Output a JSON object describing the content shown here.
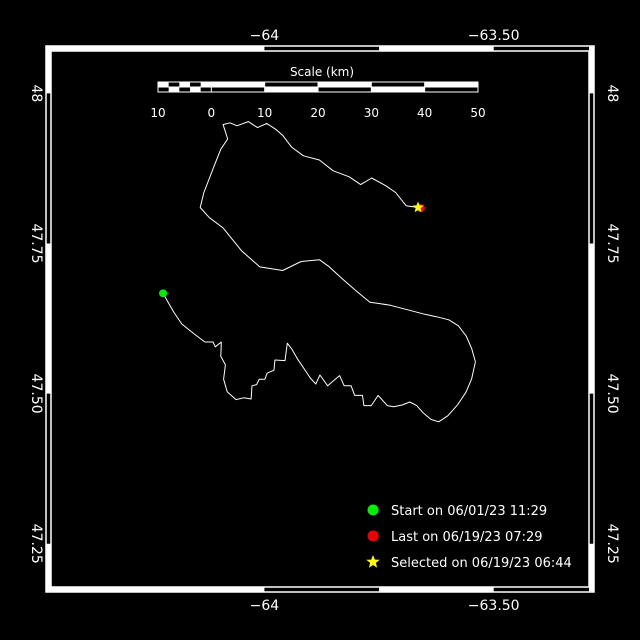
{
  "map": {
    "axes": {
      "lon_ticks": [
        {
          "value": -64,
          "label": "−64"
        },
        {
          "value": -63.5,
          "label": "−63.50"
        }
      ],
      "lat_ticks": [
        {
          "value": 48,
          "label": "48"
        },
        {
          "value": 47.75,
          "label": "47.75"
        },
        {
          "value": 47.5,
          "label": "47.50"
        },
        {
          "value": 47.25,
          "label": "47.25"
        }
      ],
      "lon_range": [
        -64.4762,
        -63.2813
      ],
      "lat_range": [
        47.1696,
        48.0789
      ]
    },
    "scale_bar": {
      "title": "Scale (km)",
      "labels": [
        "10",
        "0",
        "10",
        "20",
        "30",
        "40",
        "50"
      ],
      "max_km": 50
    },
    "track": [
      [
        -64.221,
        47.667
      ],
      [
        -64.21,
        47.652
      ],
      [
        -64.198,
        47.636
      ],
      [
        -64.18,
        47.616
      ],
      [
        -64.154,
        47.6
      ],
      [
        -64.13,
        47.586
      ],
      [
        -64.112,
        47.586
      ],
      [
        -64.107,
        47.578
      ],
      [
        -64.094,
        47.586
      ],
      [
        -64.095,
        47.562
      ],
      [
        -64.085,
        47.548
      ],
      [
        -64.089,
        47.524
      ],
      [
        -64.081,
        47.503
      ],
      [
        -64.062,
        47.49
      ],
      [
        -64.045,
        47.493
      ],
      [
        -64.029,
        47.491
      ],
      [
        -64.027,
        47.513
      ],
      [
        -64.017,
        47.515
      ],
      [
        -64.011,
        47.524
      ],
      [
        -63.999,
        47.524
      ],
      [
        -63.994,
        47.534
      ],
      [
        -63.979,
        47.539
      ],
      [
        -63.977,
        47.556
      ],
      [
        -63.955,
        47.555
      ],
      [
        -63.95,
        47.584
      ],
      [
        -63.94,
        47.574
      ],
      [
        -63.928,
        47.558
      ],
      [
        -63.913,
        47.541
      ],
      [
        -63.9,
        47.526
      ],
      [
        -63.888,
        47.516
      ],
      [
        -63.879,
        47.531
      ],
      [
        -63.862,
        47.513
      ],
      [
        -63.85,
        47.521
      ],
      [
        -63.836,
        47.53
      ],
      [
        -63.826,
        47.513
      ],
      [
        -63.811,
        47.513
      ],
      [
        -63.803,
        47.497
      ],
      [
        -63.786,
        47.497
      ],
      [
        -63.783,
        47.48
      ],
      [
        -63.767,
        47.48
      ],
      [
        -63.752,
        47.497
      ],
      [
        -63.732,
        47.48
      ],
      [
        -63.718,
        47.478
      ],
      [
        -63.7,
        47.481
      ],
      [
        -63.683,
        47.486
      ],
      [
        -63.668,
        47.48
      ],
      [
        -63.654,
        47.468
      ],
      [
        -63.637,
        47.457
      ],
      [
        -63.62,
        47.453
      ],
      [
        -63.6,
        47.463
      ],
      [
        -63.578,
        47.482
      ],
      [
        -63.56,
        47.503
      ],
      [
        -63.548,
        47.525
      ],
      [
        -63.54,
        47.553
      ],
      [
        -63.548,
        47.575
      ],
      [
        -63.56,
        47.596
      ],
      [
        -63.577,
        47.613
      ],
      [
        -63.598,
        47.623
      ],
      [
        -63.625,
        47.628
      ],
      [
        -63.65,
        47.632
      ],
      [
        -63.675,
        47.637
      ],
      [
        -63.7,
        47.642
      ],
      [
        -63.725,
        47.647
      ],
      [
        -63.75,
        47.65
      ],
      [
        -63.77,
        47.652
      ],
      [
        -63.8,
        47.671
      ],
      [
        -63.83,
        47.691
      ],
      [
        -63.86,
        47.712
      ],
      [
        -63.88,
        47.723
      ],
      [
        -63.92,
        47.72
      ],
      [
        -63.96,
        47.705
      ],
      [
        -64.01,
        47.711
      ],
      [
        -64.05,
        47.738
      ],
      [
        -64.09,
        47.776
      ],
      [
        -64.12,
        47.793
      ],
      [
        -64.14,
        47.81
      ],
      [
        -64.132,
        47.835
      ],
      [
        -64.11,
        47.878
      ],
      [
        -64.095,
        47.907
      ],
      [
        -64.08,
        47.924
      ],
      [
        -64.09,
        47.948
      ],
      [
        -64.075,
        47.951
      ],
      [
        -64.06,
        47.946
      ],
      [
        -64.035,
        47.953
      ],
      [
        -64.015,
        47.943
      ],
      [
        -63.995,
        47.95
      ],
      [
        -63.975,
        47.94
      ],
      [
        -63.96,
        47.93
      ],
      [
        -63.94,
        47.91
      ],
      [
        -63.915,
        47.896
      ],
      [
        -63.88,
        47.889
      ],
      [
        -63.85,
        47.871
      ],
      [
        -63.815,
        47.861
      ],
      [
        -63.79,
        47.848
      ],
      [
        -63.766,
        47.859
      ],
      [
        -63.735,
        47.846
      ],
      [
        -63.714,
        47.835
      ],
      [
        -63.691,
        47.813
      ],
      [
        -63.665,
        47.81
      ]
    ],
    "markers": {
      "start": {
        "lon": -64.221,
        "lat": 47.667,
        "color": "#00ee00"
      },
      "last": {
        "lon": -63.659,
        "lat": 47.809,
        "color": "#ee0000"
      },
      "selected": {
        "lon": -63.665,
        "lat": 47.81,
        "color": "#ffff00"
      }
    },
    "legend": [
      {
        "key": "start",
        "label": "Start on 06/01/23 11:29"
      },
      {
        "key": "last",
        "label": "Last on 06/19/23 07:29"
      },
      {
        "key": "selected",
        "label": "Selected on 06/19/23 06:44"
      }
    ]
  }
}
